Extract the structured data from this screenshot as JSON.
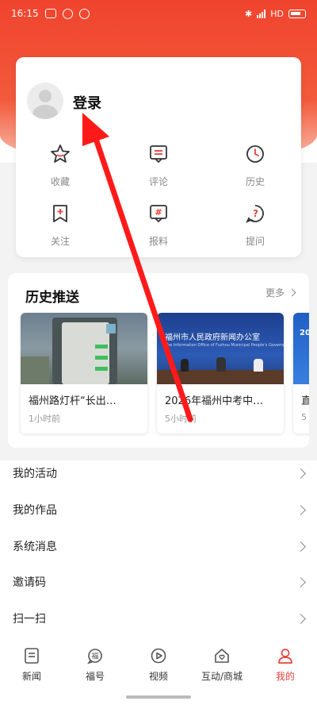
{
  "status_bar": {
    "time": "16:15",
    "network": "HD"
  },
  "profile": {
    "login_label": "登录"
  },
  "quick_actions": [
    {
      "label": "收藏",
      "icon": "star-icon"
    },
    {
      "label": "评论",
      "icon": "comment-icon"
    },
    {
      "label": "历史",
      "icon": "clock-icon"
    },
    {
      "label": "关注",
      "icon": "bookmark-plus-icon"
    },
    {
      "label": "报料",
      "icon": "hashtag-message-icon"
    },
    {
      "label": "提问",
      "icon": "question-icon"
    }
  ],
  "history": {
    "title": "历史推送",
    "more": "更多",
    "items": [
      {
        "title": "福州路灯杆“长出…",
        "time": "1小时前"
      },
      {
        "title": "2026年福州中考中…",
        "time": "5小时前",
        "banner": "福州市人民政府新闻办公室",
        "banner_sub": "The Information Office of Fuzhou Municipal People's Government"
      },
      {
        "title": "直",
        "time": "5",
        "banner": "20"
      }
    ]
  },
  "menu": [
    {
      "label": "我的活动"
    },
    {
      "label": "我的作品"
    },
    {
      "label": "系统消息"
    },
    {
      "label": "邀请码"
    },
    {
      "label": "扫一扫"
    }
  ],
  "tabs": [
    {
      "label": "新闻",
      "icon": "news-icon"
    },
    {
      "label": "福号",
      "icon": "fuhao-icon"
    },
    {
      "label": "视频",
      "icon": "video-icon"
    },
    {
      "label": "互动/商城",
      "icon": "home-heart-icon"
    },
    {
      "label": "我的",
      "icon": "profile-icon"
    }
  ],
  "colors": {
    "brand_red": "#e8423a",
    "muted_text": "#888888"
  }
}
